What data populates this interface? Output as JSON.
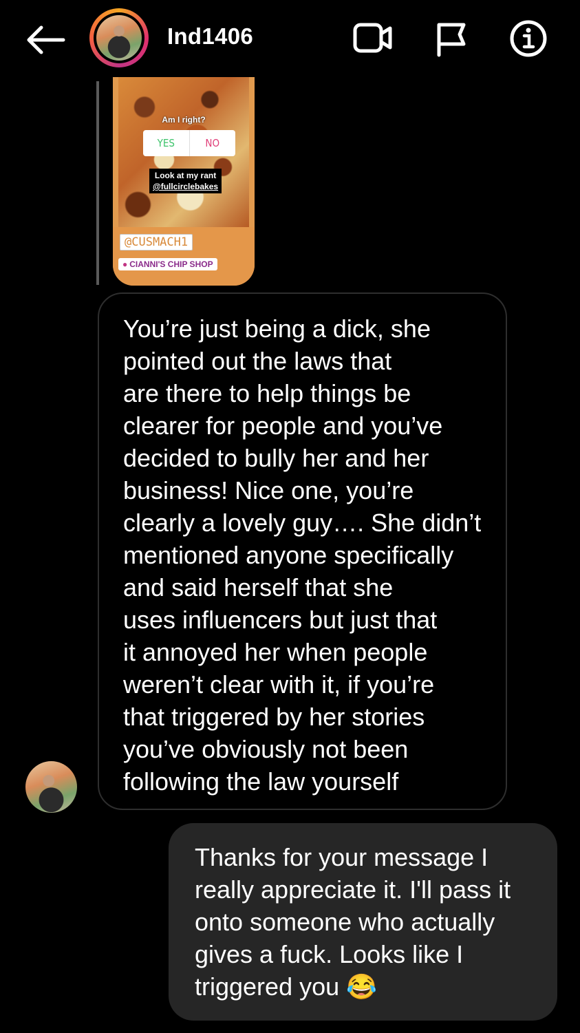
{
  "header": {
    "username": "Ind1406",
    "back_icon": "arrow-left-icon",
    "video_icon": "video-camera-icon",
    "flag_icon": "flag-icon",
    "info_icon": "info-icon"
  },
  "story_reply": {
    "poll_question": "Am I right?",
    "poll_yes": "YES",
    "poll_no": "NO",
    "rant_line1": "Look at my rant",
    "rant_line2": "@fullcirclebakes",
    "mention": "@CUSMACH1",
    "location": "CIANNI'S CHIP SHOP"
  },
  "messages": {
    "incoming": "You’re just being a dick, she\npointed out the laws that\nare there to help things be\nclearer for people and you’ve\ndecided to bully her and her\nbusiness! Nice one, you’re\nclearly a lovely guy…. She didn’t\nmentioned anyone specifically\nand said herself that she\nuses influencers but just that\nit annoyed her when people\nweren’t clear with it, if you’re\nthat triggered by her stories\nyou’ve obviously not been\nfollowing the law yourself",
    "outgoing": "Thanks for your message I\nreally appreciate it. I'll pass it\nonto someone who actually\ngives a fuck. Looks like I\ntriggered you 😂"
  },
  "colors": {
    "background": "#000000",
    "outgoing_bubble": "#262626",
    "incoming_border": "#2e2e2e",
    "story_bottom": "#e4974a"
  }
}
